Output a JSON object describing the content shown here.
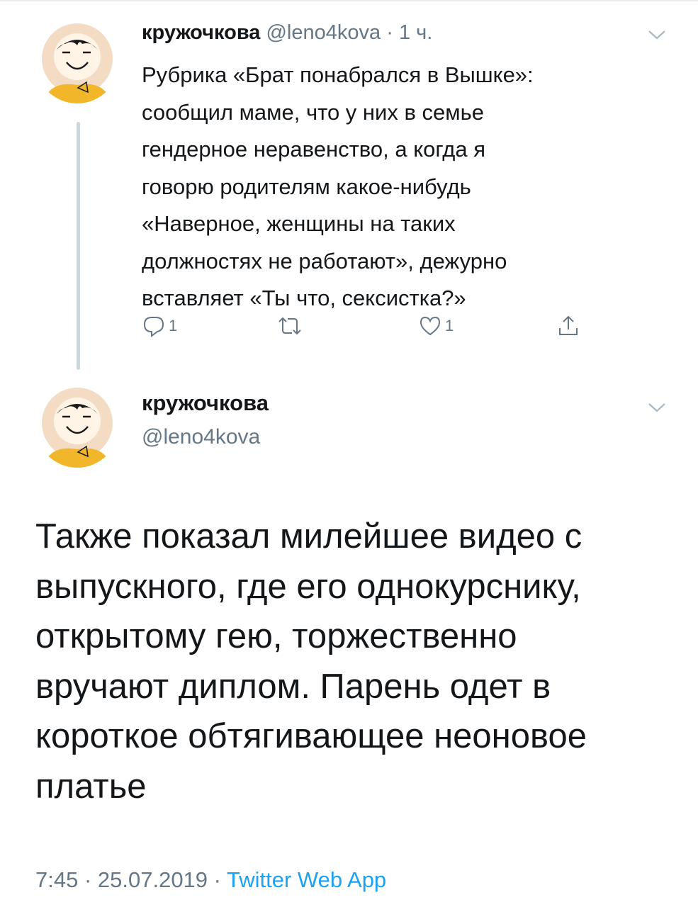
{
  "colors": {
    "text": "#14171a",
    "secondary": "#657786",
    "link": "#1da1f2",
    "thread_line": "#ccd6dd"
  },
  "reply_tweet": {
    "author_name": "кружочкова",
    "author_handle": "@leno4kova",
    "separator": "·",
    "time": "1 ч.",
    "lines": [
      "Рубрика «Брат понабрался в Вышке»:",
      "сообщил маме, что у них в семье",
      "гендерное неравенство, а когда я",
      "говорю родителям какое-нибудь",
      "«Наверное, женщины на таких",
      "должностях не работают», дежурно",
      "вставляет «Ты что, сексистка?»"
    ],
    "actions": {
      "reply_count": "1",
      "retweet_count": "",
      "like_count": "1"
    },
    "icons": [
      "reply-icon",
      "retweet-icon",
      "like-icon",
      "share-icon",
      "chevron-down-icon"
    ]
  },
  "main_tweet": {
    "author_name": "кружочкова",
    "author_handle": "@leno4kova",
    "lines": [
      "Также показал милейшее видео с",
      "выпускного, где его однокурснику,",
      "открытому гею, торжественно",
      "вручают диплом. Парень одет в",
      "короткое обтягивающее неоновое",
      "платье"
    ],
    "timestamp": "7:45 · 25.07.2019 · ",
    "source": "Twitter Web App"
  }
}
